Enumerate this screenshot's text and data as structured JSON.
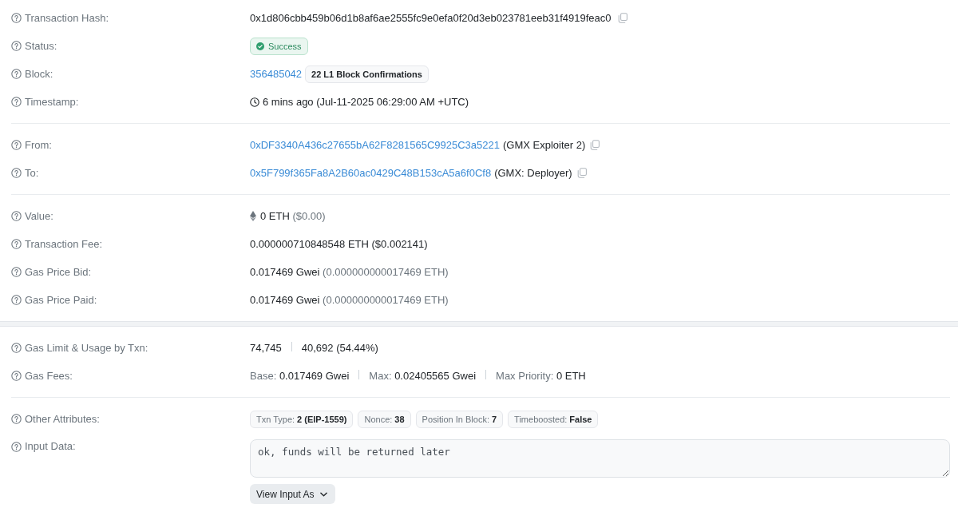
{
  "cards": [
    {
      "groups": [
        {
          "rows": [
            {
              "kind": "hash",
              "label": "Transaction Hash:",
              "value": "0x1d806cbb459b06d1b8af6ae2555fc9e0efa0f20d3eb023781eeb31f4919feac0",
              "copyable": true
            },
            {
              "kind": "status",
              "label": "Status:",
              "badge": {
                "kind": "success",
                "text": "Success"
              }
            },
            {
              "kind": "block",
              "label": "Block:",
              "link": "356485042",
              "confirmations": "22 L1 Block Confirmations"
            },
            {
              "kind": "timestamp",
              "label": "Timestamp:",
              "value": "6 mins ago (Jul-11-2025 06:29:00 AM +UTC)"
            }
          ]
        },
        {
          "rows": [
            {
              "kind": "address",
              "label": "From:",
              "link": "0xDF3340A436c27655bA62F8281565C9925C3a5221",
              "name": "(GMX Exploiter 2)",
              "copyable": true
            },
            {
              "kind": "address",
              "label": "To:",
              "link": "0x5F799f365Fa8A2B60ac0429C48B153cA5a6f0Cf8",
              "name": "(GMX: Deployer)",
              "copyable": true
            }
          ]
        },
        {
          "rows": [
            {
              "kind": "ether",
              "label": "Value:",
              "segments": [
                {
                  "parts": [
                    {
                      "text": "0 ETH",
                      "muted": false
                    },
                    {
                      "text": "($0.00)",
                      "muted": true
                    }
                  ]
                }
              ]
            },
            {
              "kind": "text",
              "label": "Transaction Fee:",
              "segments": [
                {
                  "parts": [
                    {
                      "text": "0.000000710848548 ETH ($0.002141)",
                      "muted": false
                    }
                  ]
                }
              ]
            },
            {
              "kind": "text",
              "label": "Gas Price Bid:",
              "segments": [
                {
                  "parts": [
                    {
                      "text": "0.017469 Gwei",
                      "muted": false
                    },
                    {
                      "text": "(0.000000000017469 ETH)",
                      "muted": true
                    }
                  ]
                }
              ]
            },
            {
              "kind": "text",
              "label": "Gas Price Paid:",
              "segments": [
                {
                  "parts": [
                    {
                      "text": "0.017469 Gwei",
                      "muted": false
                    },
                    {
                      "text": "(0.000000000017469 ETH)",
                      "muted": true
                    }
                  ]
                }
              ]
            }
          ]
        }
      ]
    },
    {
      "groups": [
        {
          "rows": [
            {
              "kind": "text",
              "label": "Gas Limit & Usage by Txn:",
              "segments": [
                {
                  "parts": [
                    {
                      "text": "74,745",
                      "muted": false
                    }
                  ]
                },
                {
                  "parts": [
                    {
                      "text": "40,692 (54.44%)",
                      "muted": false
                    }
                  ]
                }
              ]
            },
            {
              "kind": "text",
              "label": "Gas Fees:",
              "segments": [
                {
                  "parts": [
                    {
                      "text": "Base:",
                      "muted": true
                    },
                    {
                      "text": "0.017469 Gwei",
                      "muted": false
                    }
                  ]
                },
                {
                  "parts": [
                    {
                      "text": "Max:",
                      "muted": true
                    },
                    {
                      "text": "0.02405565 Gwei",
                      "muted": false
                    }
                  ]
                },
                {
                  "parts": [
                    {
                      "text": "Max Priority:",
                      "muted": true
                    },
                    {
                      "text": "0 ETH",
                      "muted": false
                    }
                  ]
                }
              ]
            }
          ]
        },
        {
          "rows": [
            {
              "kind": "attributes",
              "label": "Other Attributes:",
              "tags": [
                {
                  "name": "Txn Type:",
                  "value": "2 (EIP-1559)"
                },
                {
                  "name": "Nonce:",
                  "value": "38"
                },
                {
                  "name": "Position In Block:",
                  "value": "7"
                },
                {
                  "name": "Timeboosted:",
                  "value": "False"
                }
              ]
            },
            {
              "kind": "input",
              "label": "Input Data:",
              "value": "ok, funds will be returned later",
              "button": "View Input As"
            }
          ]
        }
      ]
    }
  ]
}
